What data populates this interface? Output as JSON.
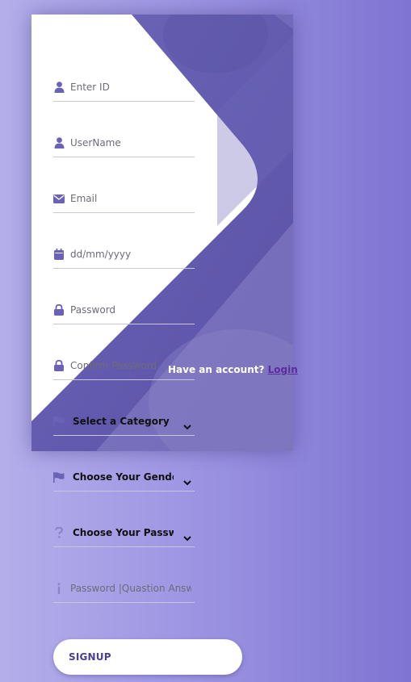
{
  "theme": {
    "accent": "#6a62b7",
    "card_dark": "#5b52a8",
    "link": "#5b2c9c",
    "background_start": "#b4aeea",
    "background_end": "#7f74d2"
  },
  "form": {
    "fields": [
      {
        "icon": "user-icon",
        "placeholder": "Enter ID"
      },
      {
        "icon": "user-icon",
        "placeholder": "UserName"
      },
      {
        "icon": "envelope-icon",
        "placeholder": "Email"
      },
      {
        "icon": "calendar-icon",
        "placeholder": "dd/mm/yyyy"
      },
      {
        "icon": "lock-icon",
        "placeholder": "Password"
      },
      {
        "icon": "lock-icon",
        "placeholder": "Confirm Password"
      }
    ],
    "selects": [
      {
        "icon": "flag-icon",
        "value": "Select a Category"
      },
      {
        "icon": "flag-icon",
        "value": "Choose Your Gender"
      },
      {
        "icon": "question-icon",
        "value": "Choose Your Password Question"
      }
    ],
    "answer": {
      "icon": "info-icon",
      "placeholder": "Password |Quastion Answer"
    }
  },
  "account": {
    "prompt": "Have an account?",
    "login_label": "Login"
  },
  "signup_label": "SIGNUP"
}
